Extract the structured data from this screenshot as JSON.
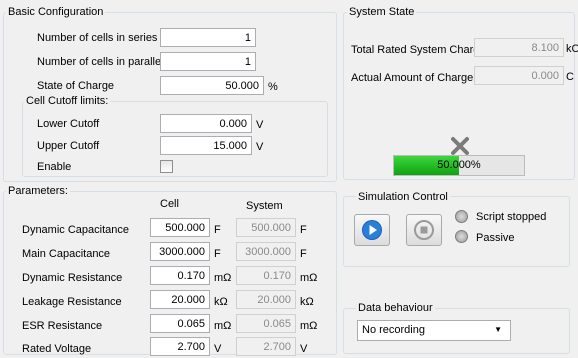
{
  "basic": {
    "title": "Basic Configuration",
    "cells_series_label": "Number of cells in series",
    "cells_series_value": "1",
    "cells_parallel_label": "Number of cells in parallel",
    "cells_parallel_value": "1",
    "soc_label": "State of Charge",
    "soc_value": "50.000",
    "soc_unit": "%",
    "cutoff_title": "Cell Cutoff limits:",
    "lower_label": "Lower Cutoff",
    "lower_value": "0.000",
    "lower_unit": "V",
    "upper_label": "Upper Cutoff",
    "upper_value": "15.000",
    "upper_unit": "V",
    "enable_label": "Enable"
  },
  "params": {
    "title": "Parameters:",
    "col_cell": "Cell",
    "col_system": "System",
    "rows": [
      {
        "label": "Dynamic Capacitance",
        "cell": "500.000",
        "cell_unit": "F",
        "system": "500.000",
        "system_unit": "F"
      },
      {
        "label": "Main Capacitance",
        "cell": "3000.000",
        "cell_unit": "F",
        "system": "3000.000",
        "system_unit": "F"
      },
      {
        "label": "Dynamic Resistance",
        "cell": "0.170",
        "cell_unit": "mΩ",
        "system": "0.170",
        "system_unit": "mΩ"
      },
      {
        "label": "Leakage Resistance",
        "cell": "20.000",
        "cell_unit": "kΩ",
        "system": "20.000",
        "system_unit": "kΩ"
      },
      {
        "label": "ESR Resistance",
        "cell": "0.065",
        "cell_unit": "mΩ",
        "system": "0.065",
        "system_unit": "mΩ"
      },
      {
        "label": "Rated Voltage",
        "cell": "2.700",
        "cell_unit": "V",
        "system": "2.700",
        "system_unit": "V"
      }
    ]
  },
  "state": {
    "title": "System State",
    "total_label": "Total Rated System Charge",
    "total_value": "8.100",
    "total_unit": "kC",
    "actual_label": "Actual Amount of Charge",
    "actual_value": "0.000",
    "actual_unit": "C",
    "status_icon": "x-mark-icon",
    "progress_text": "50.000%",
    "progress": 0.5
  },
  "simulation": {
    "title": "Simulation Control",
    "status1": "Script stopped",
    "status2": "Passive"
  },
  "data_behaviour": {
    "title": "Data behaviour",
    "selected": "No recording"
  }
}
